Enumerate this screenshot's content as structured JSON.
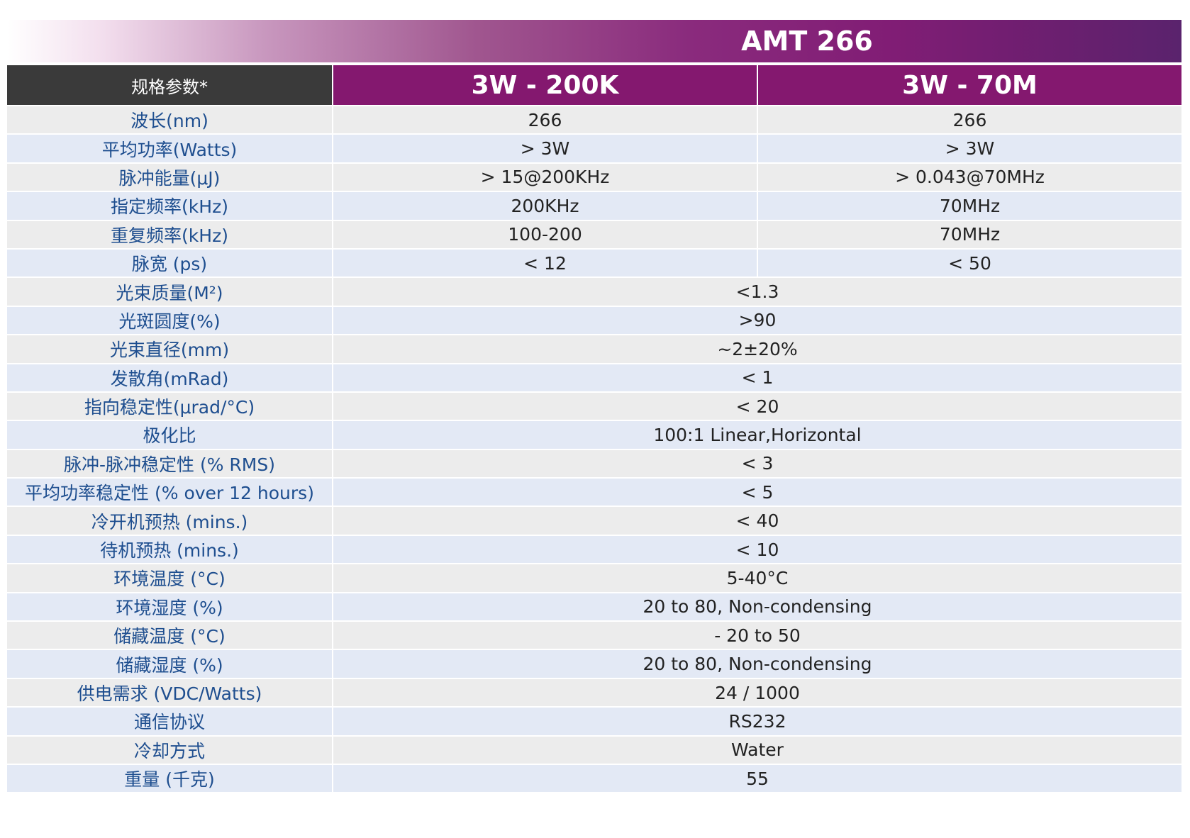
{
  "title": "AMT 266",
  "header": {
    "param_label": "规格参数*",
    "models": [
      "3W - 200K",
      "3W - 70M"
    ]
  },
  "rows": [
    {
      "label": "波长(nm)",
      "values": [
        "266",
        "266"
      ]
    },
    {
      "label": "平均功率(Watts)",
      "values": [
        "> 3W",
        "> 3W"
      ]
    },
    {
      "label": "脉冲能量(μJ)",
      "values": [
        "> 15@200KHz",
        "> 0.043@70MHz"
      ]
    },
    {
      "label": "指定频率(kHz)",
      "values": [
        "200KHz",
        "70MHz"
      ]
    },
    {
      "label": "重复频率(kHz)",
      "values": [
        "100-200",
        "70MHz"
      ]
    },
    {
      "label": "脉宽 (ps)",
      "values": [
        "< 12",
        "< 50"
      ]
    },
    {
      "label": "光束质量(M²)",
      "value": "<1.3"
    },
    {
      "label": "光斑圆度(%)",
      "value": ">90"
    },
    {
      "label": "光束直径(mm)",
      "value": "~2±20%"
    },
    {
      "label": "发散角(mRad)",
      "value": "< 1"
    },
    {
      "label": "指向稳定性(μrad/°C)",
      "value": "< 20"
    },
    {
      "label": "极化比",
      "value": "100:1 Linear,Horizontal"
    },
    {
      "label": "脉冲-脉冲稳定性 (% RMS)",
      "value": "< 3"
    },
    {
      "label": "平均功率稳定性 (% over 12 hours)",
      "value": "< 5"
    },
    {
      "label": "冷开机预热 (mins.)",
      "value": "< 40"
    },
    {
      "label": "待机预热 (mins.)",
      "value": "< 10"
    },
    {
      "label": "环境温度 (°C)",
      "value": "5-40°C"
    },
    {
      "label": "环境湿度 (%)",
      "value": "20 to 80, Non-condensing"
    },
    {
      "label": "储藏温度 (°C)",
      "value": "- 20 to 50"
    },
    {
      "label": "储藏湿度 (%)",
      "value": "20 to 80, Non-condensing"
    },
    {
      "label": "供电需求 (VDC/Watts)",
      "value": "24 / 1000"
    },
    {
      "label": "通信协议",
      "value": "RS232"
    },
    {
      "label": "冷却方式",
      "value": "Water"
    },
    {
      "label": "重量 (千克)",
      "value": "55"
    }
  ],
  "colors": {
    "banner_accent": "#84186f",
    "header_dark": "#3a3a3a",
    "label_text": "#1e4e8f",
    "row_grey": "#ececec",
    "row_blue": "#e3e9f5"
  }
}
